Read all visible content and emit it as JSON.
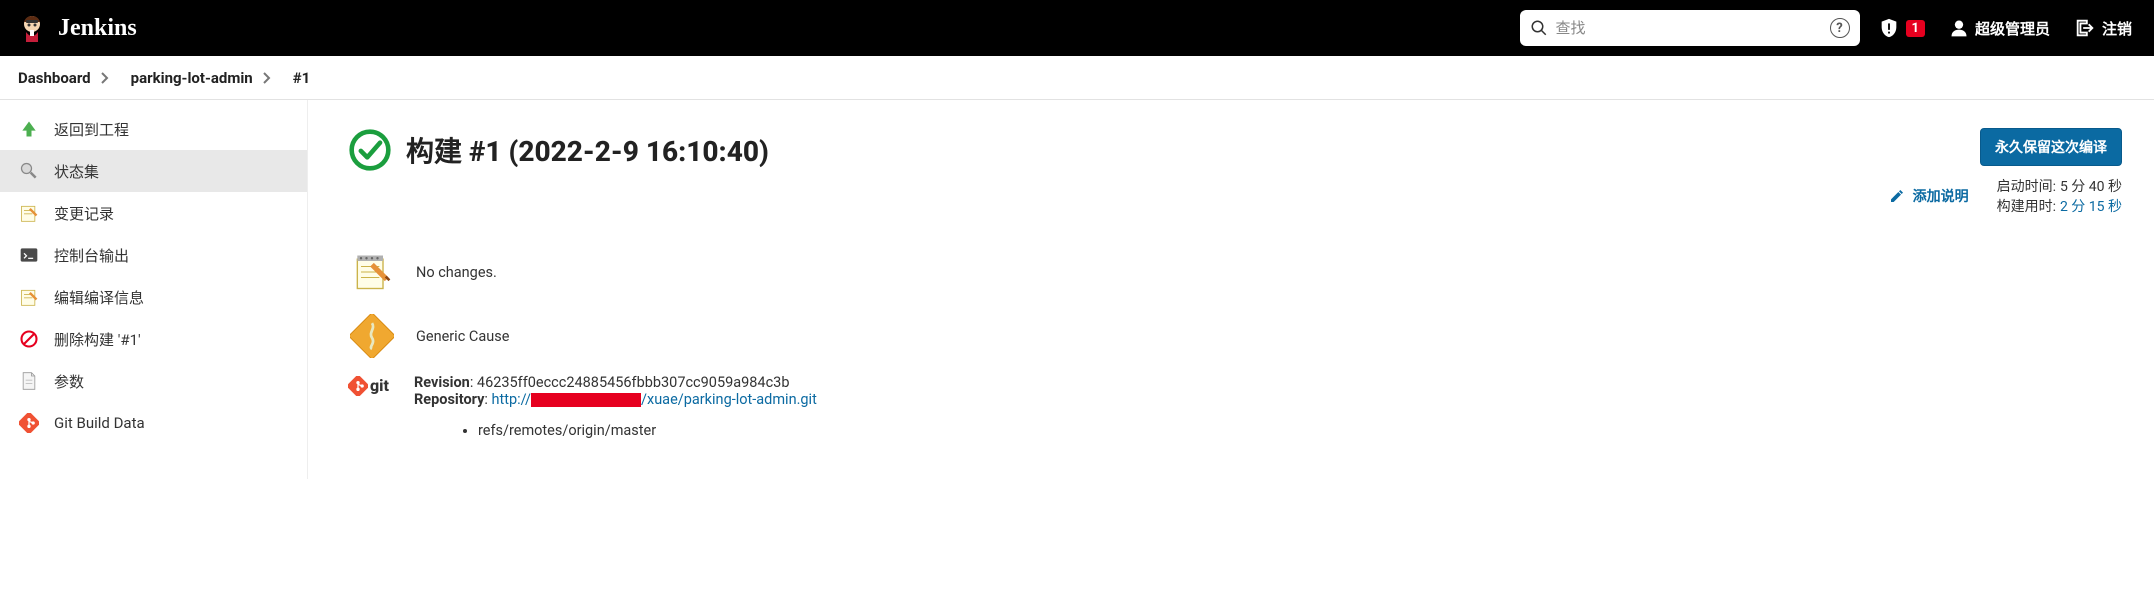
{
  "header": {
    "product_name": "Jenkins",
    "search_placeholder": "查找",
    "alert_count": "1",
    "user_label": "超级管理员",
    "logout_label": "注销"
  },
  "breadcrumbs": {
    "items": [
      "Dashboard",
      "parking-lot-admin",
      "#1"
    ]
  },
  "sidebar": {
    "items": [
      {
        "label": "返回到工程",
        "icon": "arrow-up-green"
      },
      {
        "label": "状态集",
        "icon": "magnifier",
        "active": true
      },
      {
        "label": "变更记录",
        "icon": "notepad"
      },
      {
        "label": "控制台输出",
        "icon": "terminal"
      },
      {
        "label": "编辑编译信息",
        "icon": "notepad"
      },
      {
        "label": "删除构建 '#1'",
        "icon": "forbidden"
      },
      {
        "label": "参数",
        "icon": "document"
      },
      {
        "label": "Git Build Data",
        "icon": "git-diamond"
      }
    ]
  },
  "main": {
    "title": "构建 #1 (2022-2-9 16:10:40)",
    "keep_forever_label": "永久保留这次编译",
    "add_desc_label": "添加说明",
    "timing": {
      "start_label": "启动时间:",
      "start_value": "5 分 40 秒",
      "duration_label": "构建用时:",
      "duration_value": "2 分 15 秒"
    },
    "changes_text": "No changes.",
    "cause_text": "Generic Cause",
    "git": {
      "revision_label": "Revision",
      "revision_value": "46235ff0eccc24885456fbbb307cc9059a984c3b",
      "repository_label": "Repository",
      "repo_url_prefix": "http://",
      "repo_url_suffix": "/xuae/parking-lot-admin.git",
      "refs": [
        "refs/remotes/origin/master"
      ]
    }
  }
}
